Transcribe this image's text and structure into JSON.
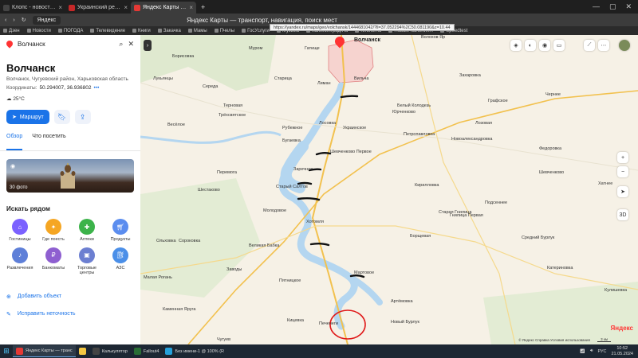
{
  "browser": {
    "tabs": [
      {
        "label": "Клопс - новости Калинин...",
        "color": "#444444"
      },
      {
        "label": "Украинский ресурс: Про...",
        "color": "#c62828"
      },
      {
        "label": "Яндекс Карты — транс",
        "color": "#e53935",
        "active": true
      }
    ],
    "new_tab": "+",
    "window_title": "Яндекс Карты — транспорт, навигация, поиск мест",
    "url_host": "Яндекс",
    "url_tooltip": "https://yandex.ru/maps/geo/volchansk/1444681042/?ll=37.052294%2C50.081190&z=10.44",
    "bookmarks": [
      "Дзен",
      "Новости",
      "ПОГОДА",
      "Телевидение",
      "Книги",
      "Закачка",
      "Мамы",
      "Пчелы",
      "ГосУслуги",
      "Музыка",
      "Калининград.Ru",
      "Клопс.Ru",
      "Новый Калинин...",
      "Speedtest"
    ]
  },
  "panel": {
    "search_value": "Волчанск",
    "title": "Волчанск",
    "subtitle": "Волчанск, Чугуевский район, Харьковская область",
    "coords_label": "Координаты:",
    "coords_value": "50.294007, 36.936802",
    "weather": "25°C",
    "route_label": "Маршрут",
    "tabs": [
      "Обзор",
      "Что посетить"
    ],
    "photo_label": "30 фото",
    "nearby_title": "Искать рядом",
    "categories": [
      {
        "label": "Гостиницы",
        "color": "#7b61ff",
        "icon": "bed-icon"
      },
      {
        "label": "Где поесть",
        "color": "#f5a623",
        "icon": "food-icon"
      },
      {
        "label": "Аптеки",
        "color": "#3cb34a",
        "icon": "pharmacy-icon"
      },
      {
        "label": "Продукты",
        "color": "#5b8def",
        "icon": "cart-icon"
      },
      {
        "label": "Развлечения",
        "color": "#5e7fd8",
        "icon": "entertainment-icon"
      },
      {
        "label": "Банкоматы",
        "color": "#8e5fd0",
        "icon": "atm-icon"
      },
      {
        "label": "Торговые центры",
        "color": "#6c7fd1",
        "icon": "mall-icon"
      },
      {
        "label": "АЗС",
        "color": "#4b8fe8",
        "icon": "gas-icon"
      }
    ],
    "add_object": "Добавить объект",
    "fix_error": "Исправить неточность"
  },
  "map": {
    "labels": [
      {
        "text": "Волчанск",
        "big": true
      },
      {
        "text": "Волохов Яр"
      },
      {
        "text": "Гатище"
      },
      {
        "text": "Муром"
      },
      {
        "text": "Борисовка"
      },
      {
        "text": "Лукьянцы"
      },
      {
        "text": "Середа"
      },
      {
        "text": "Старица"
      },
      {
        "text": "Лиман"
      },
      {
        "text": "Вильча"
      },
      {
        "text": "Терновая"
      },
      {
        "text": "Трёхсвятское"
      },
      {
        "text": "Весёлое"
      },
      {
        "text": "Рубежное"
      },
      {
        "text": "Лосовка"
      },
      {
        "text": "Украинское"
      },
      {
        "text": "Бугаевка"
      },
      {
        "text": "Шевченково Первое"
      },
      {
        "text": "Заречное"
      },
      {
        "text": "Перемога"
      },
      {
        "text": "Старый Салтов"
      },
      {
        "text": "Шестаково"
      },
      {
        "text": "Молодовое"
      },
      {
        "text": "Хотомля"
      },
      {
        "text": "Юрченково"
      },
      {
        "text": "Петропавловка"
      },
      {
        "text": "Лозовая"
      },
      {
        "text": "Новоалександровка"
      },
      {
        "text": "Белый Колодезь"
      },
      {
        "text": "Графское"
      },
      {
        "text": "Кирилловка"
      },
      {
        "text": "Борщевая"
      },
      {
        "text": "Мартовое"
      },
      {
        "text": "Артёмовка"
      },
      {
        "text": "Печенеги"
      },
      {
        "text": "Новый Бурлук"
      },
      {
        "text": "Великая Бабка"
      },
      {
        "text": "Заводы"
      },
      {
        "text": "Пятницкое"
      },
      {
        "text": "Кицевка"
      },
      {
        "text": "Чугуев"
      },
      {
        "text": "Каменная Яруга"
      },
      {
        "text": "Малая Рогань"
      },
      {
        "text": "Ольховка"
      },
      {
        "text": "Сороковка"
      },
      {
        "text": "Федоровка"
      },
      {
        "text": "Шевченково"
      },
      {
        "text": "Хатнее"
      },
      {
        "text": "Старая Гнилица"
      },
      {
        "text": "Гнилица Первая"
      },
      {
        "text": "Подсеннее"
      },
      {
        "text": "Средний Бурлук"
      },
      {
        "text": "Катериновка"
      },
      {
        "text": "Кулишевка"
      },
      {
        "text": "Захаровка"
      },
      {
        "text": "Чернее"
      }
    ],
    "controls": [
      "layers-icon",
      "traffic-icon",
      "camera-icon",
      "transit-icon",
      "ruler-icon",
      "more-icon"
    ],
    "zoom": [
      "+",
      "−"
    ],
    "view3d": "3D",
    "brand": "Яндекс",
    "copyright": "© Яндекс  Справка  Условия использования",
    "scale": "3 км"
  },
  "taskbar": {
    "items": [
      {
        "label": "Яндекс Карты — транс",
        "color": "#e53935",
        "active": true
      },
      {
        "label": "",
        "color": "#f5c842"
      },
      {
        "label": "Калькулятор",
        "color": "#444444"
      },
      {
        "label": "Fallout4",
        "color": "#2a6e36"
      },
      {
        "label": "Без имени-1 @ 100% (R",
        "color": "#26a0da"
      }
    ],
    "lang": "РУС",
    "time": "10:52",
    "date": "21.05.2024"
  },
  "colors": {
    "accent": "#1a73e8",
    "river": "#b4d6f0",
    "roads": "#f2c14e",
    "annotation": "#e01919"
  }
}
